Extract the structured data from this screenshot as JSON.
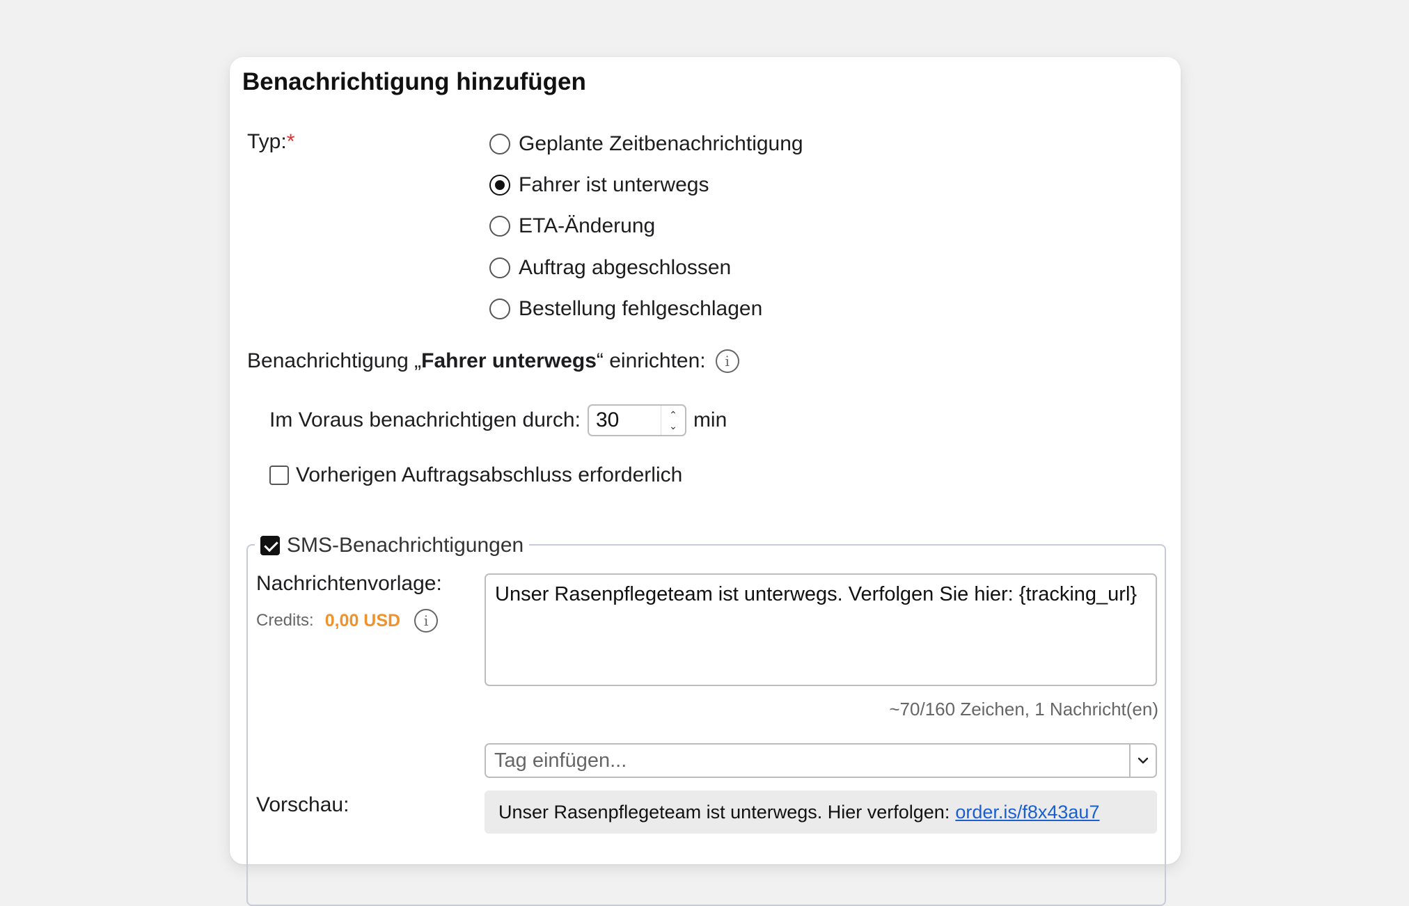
{
  "dialog": {
    "title": "Benachrichtigung hinzufügen",
    "type_label": "Typ:",
    "required_marker": "*",
    "types": [
      {
        "label": "Geplante Zeitbenachrichtigung",
        "checked": false
      },
      {
        "label": "Fahrer ist unterwegs",
        "checked": true
      },
      {
        "label": "ETA-Änderung",
        "checked": false
      },
      {
        "label": "Auftrag abgeschlossen",
        "checked": false
      },
      {
        "label": "Bestellung fehlgeschlagen",
        "checked": false
      }
    ],
    "setup": {
      "prefix": "Benachrichtigung „",
      "bold": "Fahrer unterwegs",
      "suffix": "“ einrichten:"
    },
    "advance": {
      "label": "Im Voraus benachrichtigen durch:",
      "value": "30",
      "unit": "min"
    },
    "require_previous": {
      "label": "Vorherigen Auftragsabschluss erforderlich",
      "checked": false
    },
    "sms": {
      "legend": "SMS-Benachrichtigungen",
      "enabled": true,
      "template_label": "Nachrichtenvorlage:",
      "credits_label": "Credits:",
      "credits_value": "0,00 USD",
      "template_text": "Unser Rasenpflegeteam ist unterwegs. Verfolgen Sie hier: {tracking_url}",
      "counter": "~70/160 Zeichen, 1 Nachricht(en)",
      "tag_placeholder": "Tag einfügen...",
      "preview_label": "Vorschau:",
      "preview_text": "Unser Rasenpflegeteam ist unterwegs. Hier verfolgen:",
      "preview_link": "order.is/f8x43au7"
    }
  },
  "colors": {
    "accent_orange": "#f0922b",
    "link_blue": "#1a5fd0",
    "required_red": "#e03131"
  }
}
